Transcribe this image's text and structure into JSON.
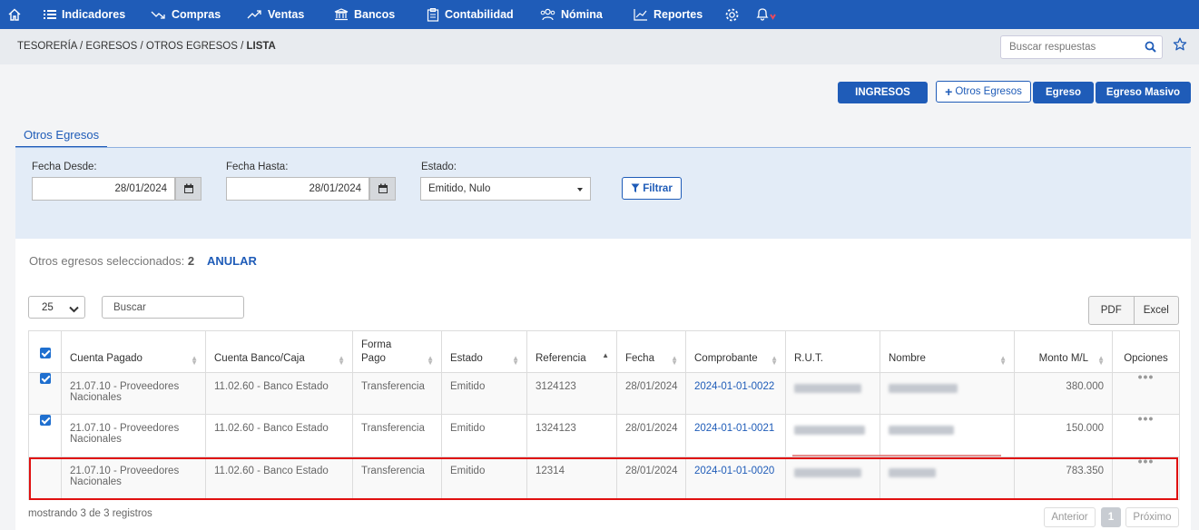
{
  "nav": {
    "items": [
      {
        "label": "Indicadores",
        "icon": "list-icon"
      },
      {
        "label": "Compras",
        "icon": "trend-down-icon"
      },
      {
        "label": "Ventas",
        "icon": "trend-up-icon"
      },
      {
        "label": "Bancos",
        "icon": "bank-icon"
      },
      {
        "label": "Contabilidad",
        "icon": "clipboard-icon"
      },
      {
        "label": "Nómina",
        "icon": "users-icon"
      },
      {
        "label": "Reportes",
        "icon": "chart-icon"
      }
    ],
    "accent": "#1f5cb8"
  },
  "breadcrumb": {
    "items": [
      "TESORERÍA",
      "EGRESOS",
      "OTROS EGRESOS"
    ],
    "current": "LISTA"
  },
  "help_search": {
    "placeholder": "Buscar respuestas"
  },
  "actions": {
    "ingresos": "INGRESOS",
    "otros_egresos": "Otros Egresos",
    "egreso": "Egreso",
    "egreso_masivo": "Egreso Masivo"
  },
  "tab": {
    "label": "Otros Egresos"
  },
  "filters": {
    "fecha_desde_label": "Fecha Desde:",
    "fecha_desde": "28/01/2024",
    "fecha_hasta_label": "Fecha Hasta:",
    "fecha_hasta": "28/01/2024",
    "estado_label": "Estado:",
    "estado": "Emitido, Nulo",
    "filtrar": "Filtrar"
  },
  "selection": {
    "text": "Otros egresos seleccionados:",
    "count": "2",
    "anular": "ANULAR"
  },
  "table_controls": {
    "page_length": "25",
    "search_placeholder": "Buscar",
    "pdf": "PDF",
    "excel": "Excel"
  },
  "table": {
    "columns": [
      "Cuenta Pagado",
      "Cuenta Banco/Caja",
      "Forma Pago",
      "Estado",
      "Referencia",
      "Fecha",
      "Comprobante",
      "R.U.T.",
      "Nombre",
      "Monto M/L",
      "Opciones"
    ],
    "forma_pago_line1": "Forma",
    "forma_pago_line2": "Pago",
    "rows": [
      {
        "checked": true,
        "cuenta_pagado_1": "21.07.10 - Proveedores",
        "cuenta_pagado_2": "Nacionales",
        "cuenta_banco": "11.02.60 - Banco Estado",
        "forma_pago": "Transferencia",
        "estado": "Emitido",
        "referencia": "3124123",
        "fecha": "28/01/2024",
        "comprobante": "2024-01-01-0022",
        "monto": "380.000"
      },
      {
        "checked": true,
        "cuenta_pagado_1": "21.07.10 - Proveedores",
        "cuenta_pagado_2": "Nacionales",
        "cuenta_banco": "11.02.60 - Banco Estado",
        "forma_pago": "Transferencia",
        "estado": "Emitido",
        "referencia": "1324123",
        "fecha": "28/01/2024",
        "comprobante": "2024-01-01-0021",
        "monto": "150.000"
      },
      {
        "checked": false,
        "cuenta_pagado_1": "21.07.10 - Proveedores",
        "cuenta_pagado_2": "Nacionales",
        "cuenta_banco": "11.02.60 - Banco Estado",
        "forma_pago": "Transferencia",
        "estado": "Emitido",
        "referencia": "12314",
        "fecha": "28/01/2024",
        "comprobante": "2024-01-01-0020",
        "monto": "783.350"
      }
    ]
  },
  "footer": {
    "info": "mostrando 3 de 3 registros",
    "prev": "Anterior",
    "page": "1",
    "next": "Próximo"
  }
}
